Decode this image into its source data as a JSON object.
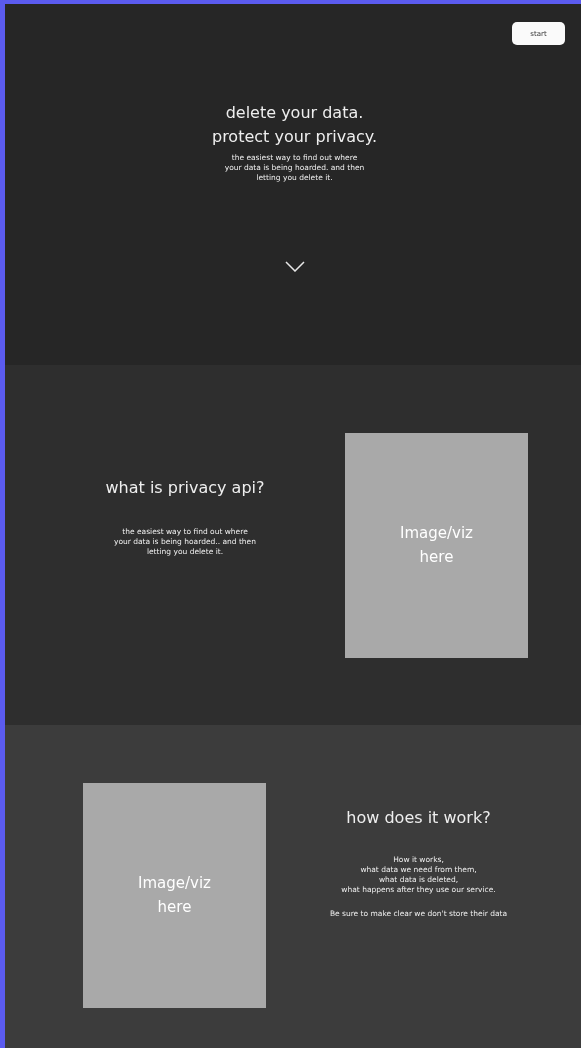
{
  "header": {
    "button": "start"
  },
  "hero": {
    "title_lines": [
      "delete your data.",
      "protect your privacy."
    ],
    "text_lines": [
      "the easiest way to find out where",
      "your data is being hoarded. and then",
      "letting you delete it."
    ]
  },
  "sections": [
    {
      "title": "what is privacy api?",
      "kind": "textfirst",
      "placeholder_lines": [
        "Image/viz",
        "here"
      ],
      "paragraphs": [
        [
          "the easiest way to find out where",
          "your data is being hoarded.. and then",
          "letting you delete it."
        ]
      ]
    },
    {
      "title": "how does it work?",
      "kind": "imagefirst",
      "placeholder_lines": [
        "Image/viz",
        "here"
      ],
      "paragraphs": [
        [
          "How it works,",
          "what data we need from them,",
          "what data is deleted,",
          "what happens after they use our service."
        ],
        [
          "Be sure to make clear we don't store their data"
        ]
      ]
    }
  ]
}
